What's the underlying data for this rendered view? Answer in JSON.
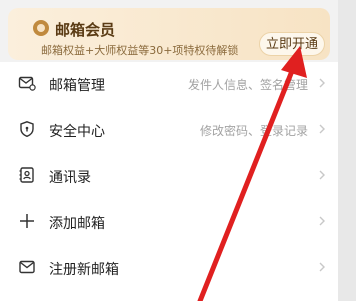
{
  "vip": {
    "title": "邮箱会员",
    "subtitle": "邮箱权益+大师权益等30+项特权待解锁",
    "button": "立即开通"
  },
  "menu": [
    {
      "label": "邮箱管理",
      "hint": "发件人信息、签名管理",
      "icon": "mailbox-gear-icon"
    },
    {
      "label": "安全中心",
      "hint": "修改密码、登录记录",
      "icon": "shield-icon"
    },
    {
      "label": "通讯录",
      "hint": "",
      "icon": "contacts-icon"
    },
    {
      "label": "添加邮箱",
      "hint": "",
      "icon": "plus-icon"
    },
    {
      "label": "注册新邮箱",
      "hint": "",
      "icon": "envelope-icon"
    }
  ],
  "annotation": {
    "color": "#e02020"
  }
}
